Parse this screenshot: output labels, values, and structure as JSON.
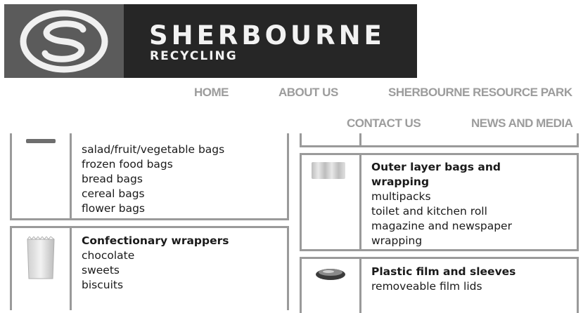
{
  "brand": {
    "title": "SHERBOURNE",
    "subtitle": "RECYCLING"
  },
  "nav": {
    "items": [
      {
        "label": "HOME"
      },
      {
        "label": "ABOUT US"
      },
      {
        "label": "SHERBOURNE RESOURCE PARK"
      },
      {
        "label": "CONTACT US"
      },
      {
        "label": "NEWS AND MEDIA"
      }
    ]
  },
  "left_column": {
    "top_panel": {
      "items": [
        "salad/fruit/vegetable bags",
        "frozen food bags",
        "bread bags",
        "cereal bags",
        "flower bags"
      ]
    },
    "confectionary": {
      "heading": "Confectionary wrappers",
      "items": [
        "chocolate",
        "sweets",
        "biscuits"
      ]
    }
  },
  "right_column": {
    "outer_layer": {
      "heading_line1": "Outer layer bags and",
      "heading_line2": "wrapping",
      "items": [
        "multipacks",
        "toilet and kitchen roll",
        "magazine and newspaper",
        "wrapping"
      ]
    },
    "plastic_film": {
      "heading": "Plastic film and sleeves",
      "items": [
        "removeable film lids"
      ]
    }
  },
  "colors": {
    "logo_dark": "#262626",
    "logo_mark": "#5b5b5b",
    "nav_text": "#9c9c9c",
    "panel_border": "#9a9a9a"
  }
}
